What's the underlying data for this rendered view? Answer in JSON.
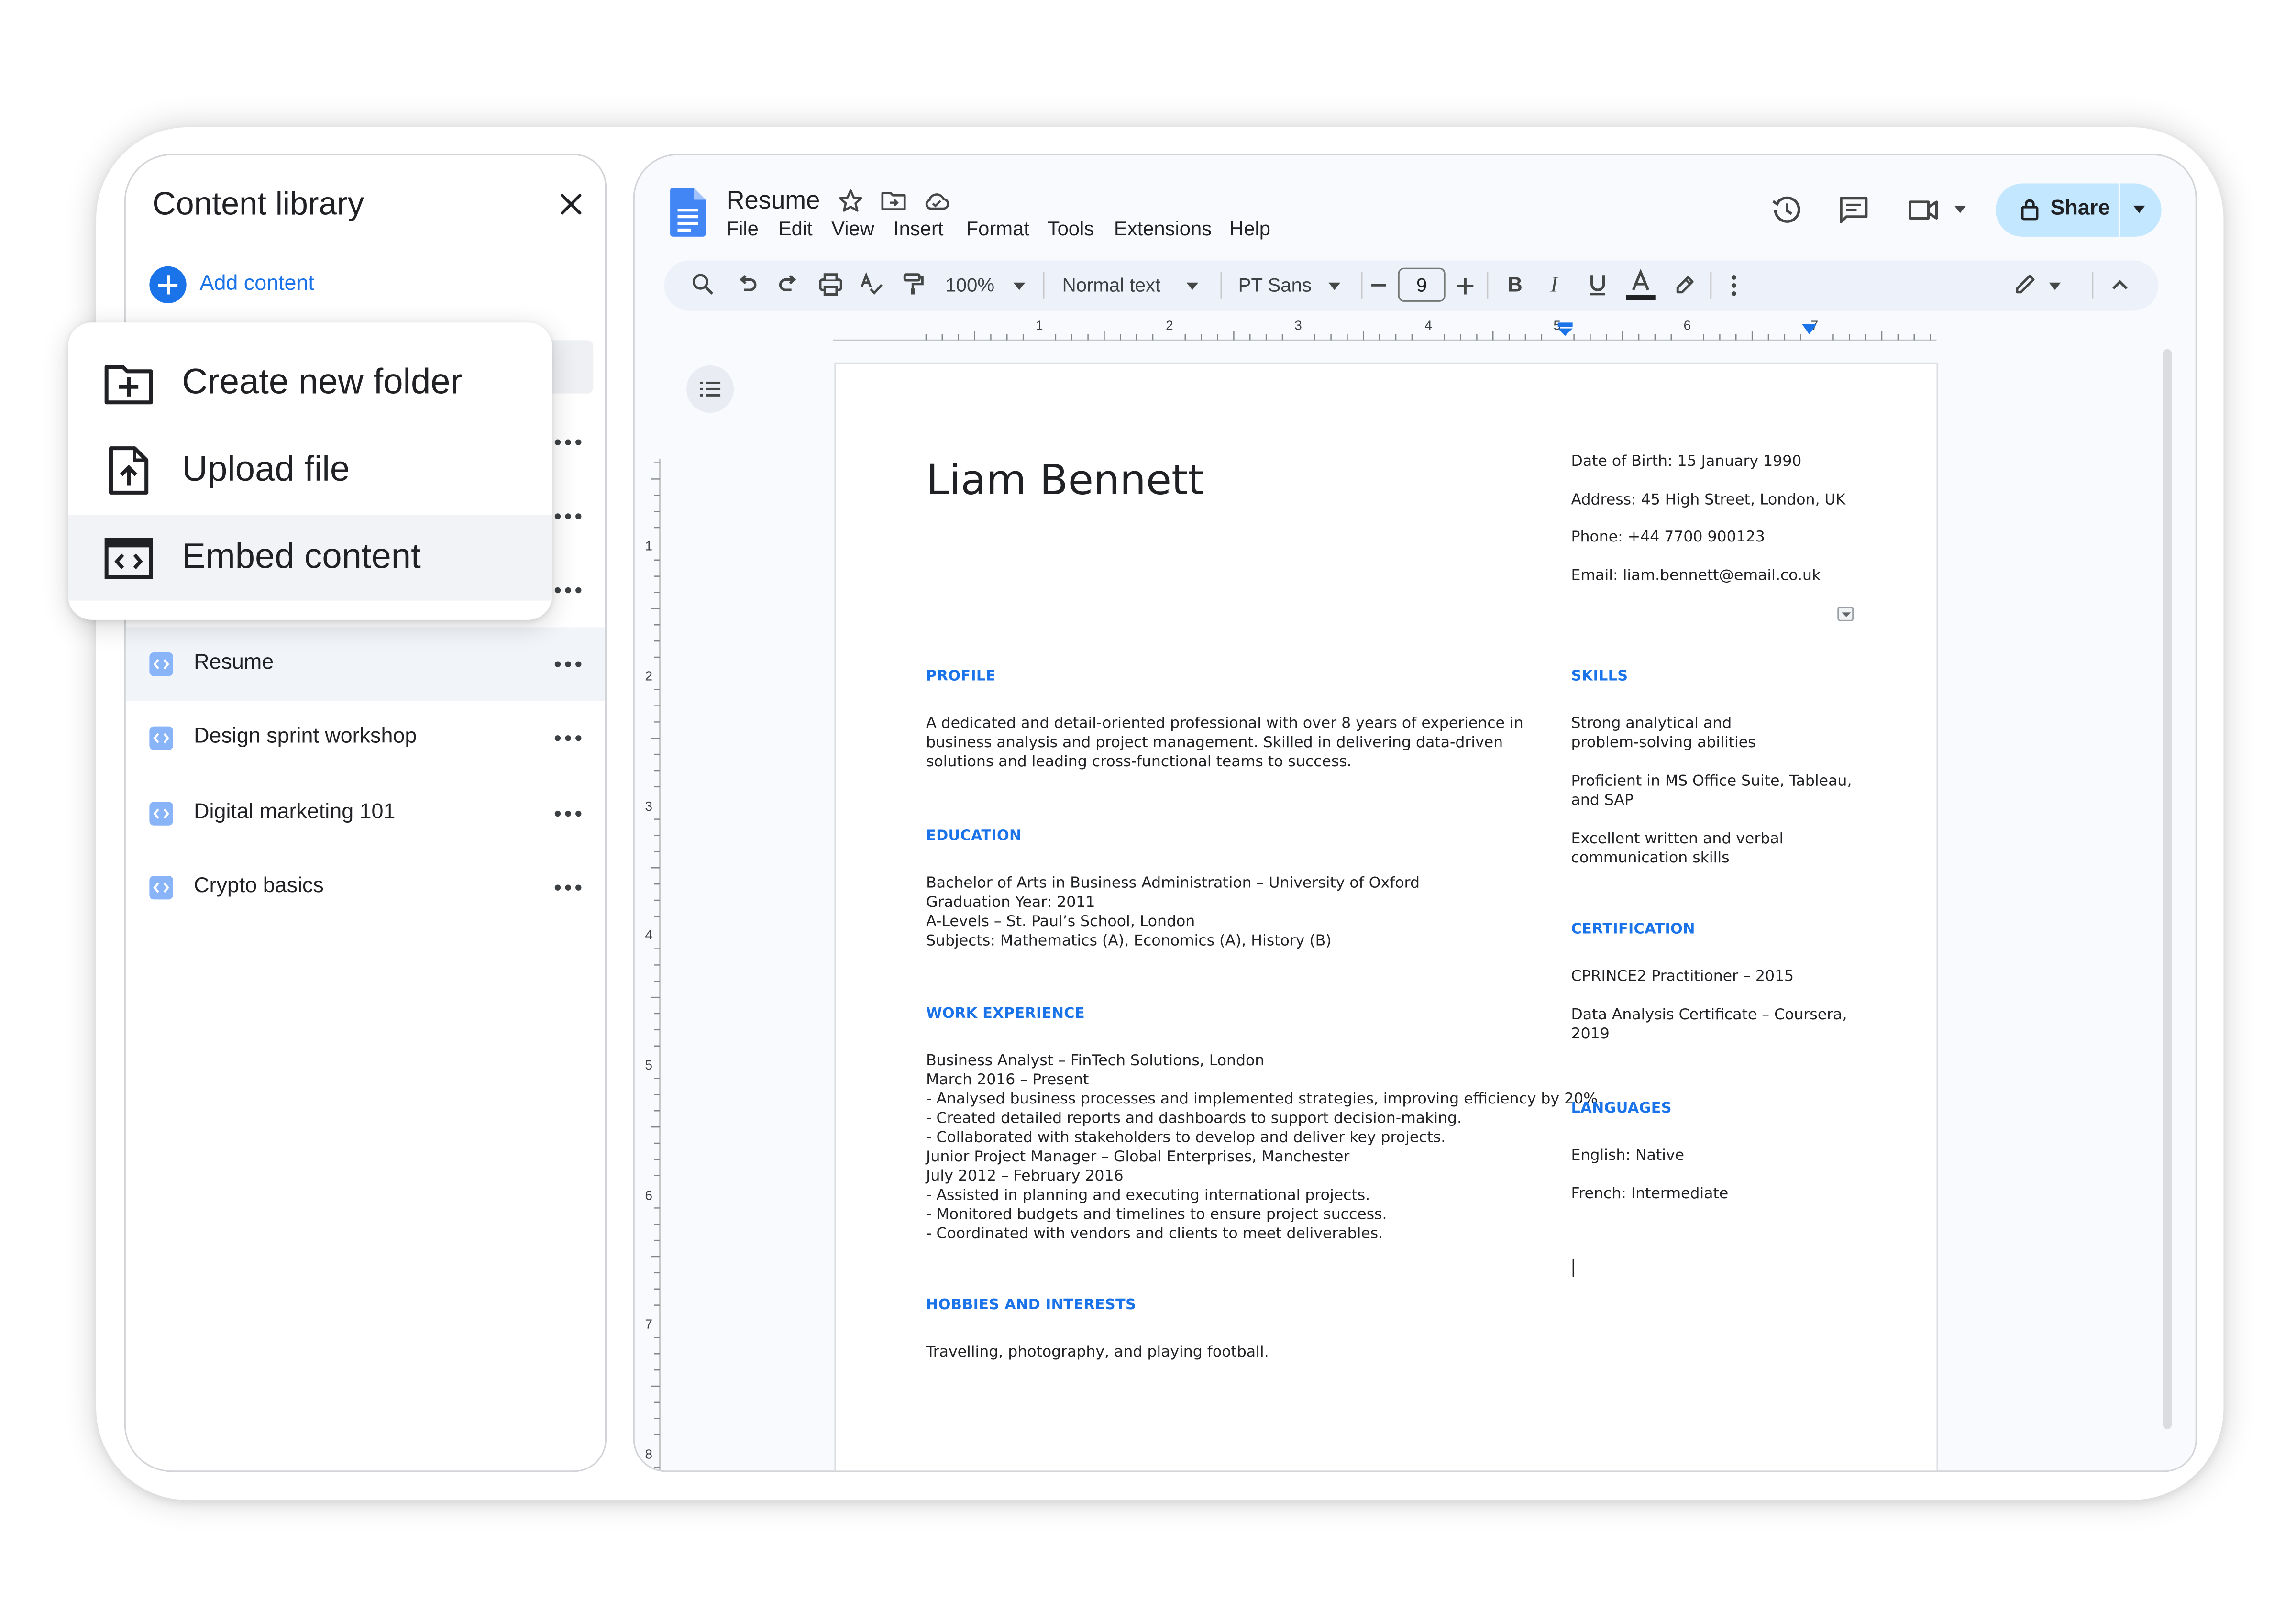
{
  "sidebar": {
    "title": "Content library",
    "add_label": "Add content",
    "items": [
      {
        "label": "Resume",
        "selected": true
      },
      {
        "label": "Design sprint workshop",
        "selected": false
      },
      {
        "label": "Digital marketing 101",
        "selected": false
      },
      {
        "label": "Crypto basics",
        "selected": false
      }
    ]
  },
  "menu": {
    "items": [
      {
        "label": "Create new folder",
        "icon": "create-folder-icon"
      },
      {
        "label": "Upload file",
        "icon": "upload-file-icon"
      },
      {
        "label": "Embed content",
        "icon": "embed-icon",
        "highlighted": true
      }
    ]
  },
  "docs": {
    "title": "Resume",
    "menus": [
      "File",
      "Edit",
      "View",
      "Insert",
      "Format",
      "Tools",
      "Extensions",
      "Help"
    ],
    "share_label": "Share",
    "toolbar": {
      "zoom": "100%",
      "style": "Normal text",
      "font": "PT Sans",
      "font_size": "9"
    },
    "ruler_h": [
      "1",
      "2",
      "3",
      "4",
      "5",
      "6",
      "7"
    ],
    "ruler_v": [
      "1",
      "2",
      "3",
      "4",
      "5",
      "6",
      "7",
      "8"
    ],
    "colors": {
      "accent": "#1a73e8",
      "share_bg": "#c2e7ff",
      "toolbar_bg": "#edf2fa"
    }
  },
  "resume": {
    "name": "Liam Bennett",
    "contact": [
      "Date of Birth: 15 January 1990",
      "Address: 45 High Street, London, UK",
      "Phone: +44 7700 900123",
      "Email: liam.bennett@email.co.uk"
    ],
    "profile_heading": "PROFILE",
    "profile_lines": [
      "A dedicated and detail-oriented professional with over 8 years of experience in",
      "business analysis and project management. Skilled in delivering data-driven",
      "solutions and leading cross-functional teams to success."
    ],
    "education_heading": "EDUCATION",
    "education_lines": [
      "Bachelor of Arts in Business Administration – University of Oxford",
      "Graduation Year: 2011",
      "A-Levels – St. Paul’s School, London",
      "Subjects: Mathematics (A), Economics (A), History (B)"
    ],
    "work_heading": "WORK EXPERIENCE",
    "work_lines": [
      "Business Analyst – FinTech Solutions, London",
      "March 2016 – Present",
      "- Analysed business processes and implemented strategies, improving efficiency by 20%.",
      "- Created detailed reports and dashboards to support decision-making.",
      "- Collaborated with stakeholders to develop and deliver key projects.",
      "Junior Project Manager – Global Enterprises, Manchester",
      "July 2012 – February 2016",
      "- Assisted in planning and executing international projects.",
      "- Monitored budgets and timelines to ensure project success.",
      "- Coordinated with vendors and clients to meet deliverables."
    ],
    "hobbies_heading": "HOBBIES AND INTERESTS",
    "hobbies_text": "Travelling, photography, and playing football.",
    "skills_heading": "SKILLS",
    "skills": [
      [
        "Strong analytical and",
        "problem-solving abilities"
      ],
      [
        "Proficient in MS Office Suite, Tableau,",
        "and SAP"
      ],
      [
        "Excellent written and verbal",
        "communication skills"
      ]
    ],
    "cert_heading": "CERTIFICATION",
    "certs": [
      [
        "CPRINCE2 Practitioner – 2015"
      ],
      [
        "Data Analysis Certificate – Coursera,",
        "2019"
      ]
    ],
    "lang_heading": "LANGUAGES",
    "languages": [
      "English: Native",
      "French: Intermediate"
    ]
  }
}
